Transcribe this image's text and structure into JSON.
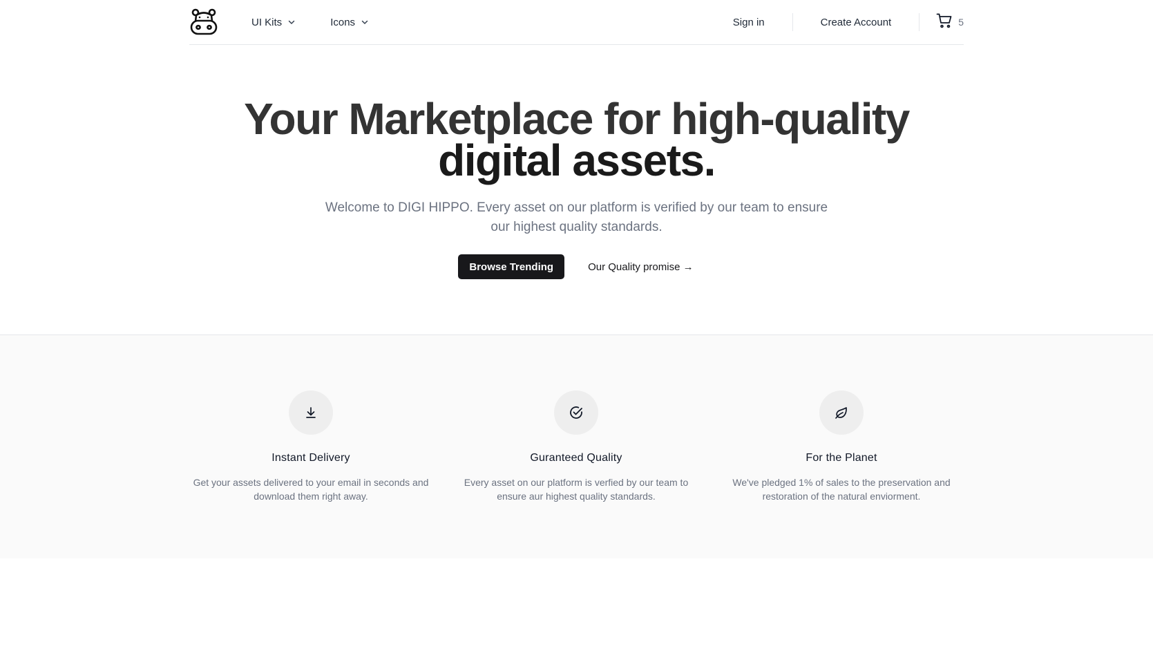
{
  "nav": {
    "logo_icon": "hippo-logo-icon",
    "menus": [
      {
        "label": "UI Kits",
        "icon": "chevron-down-icon"
      },
      {
        "label": "Icons",
        "icon": "chevron-down-icon"
      }
    ],
    "sign_in": "Sign in",
    "create_account": "Create Account",
    "cart": {
      "icon": "shopping-cart-icon",
      "count": "5"
    }
  },
  "hero": {
    "title_part1": "Your Marketplace for high-quality",
    "title_part2": "digital assets.",
    "subtitle": "Welcome to DIGI HIPPO. Every asset on our platform is verified by our team to ensure our highest quality standards.",
    "primary_button": "Browse Trending",
    "secondary_button": "Our Quality promise →"
  },
  "features": [
    {
      "icon": "download-icon",
      "title": "Instant Delivery",
      "description": "Get your assets delivered to your email in seconds and download them right away."
    },
    {
      "icon": "check-circle-icon",
      "title": "Guranteed Quality",
      "description": "Every asset on our platform is verfied by our team to ensure aur highest quality standards."
    },
    {
      "icon": "leaf-icon",
      "title": "For the Planet",
      "description": "We've pledged 1% of sales to the preservation and restoration of the natural enviorment."
    }
  ],
  "colors": {
    "primary": "#18181b",
    "muted_text": "#6b7280",
    "feature_bg": "#fafafa",
    "icon_bg": "#eeeeee"
  }
}
